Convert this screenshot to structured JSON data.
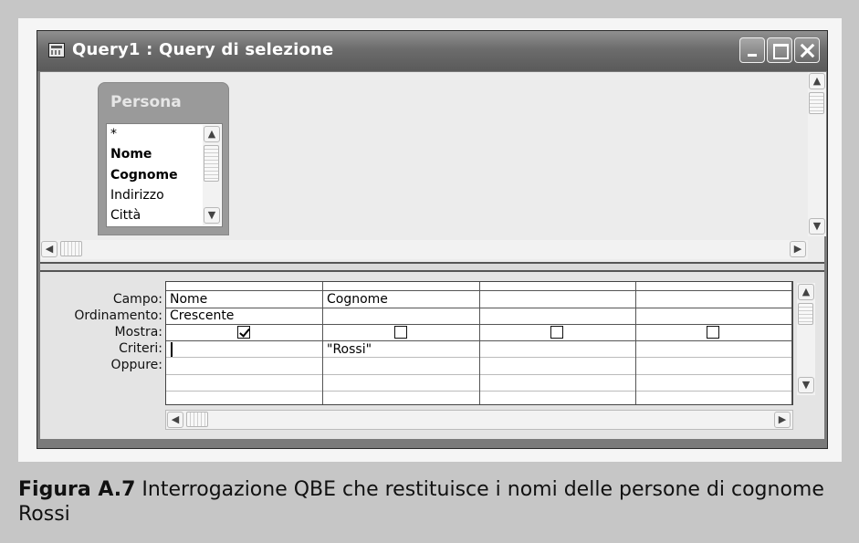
{
  "window": {
    "title": "Query1 : Query di selezione"
  },
  "table": {
    "name": "Persona",
    "fields": [
      {
        "label": "*",
        "bold": false
      },
      {
        "label": "Nome",
        "bold": true
      },
      {
        "label": "Cognome",
        "bold": true
      },
      {
        "label": "Indirizzo",
        "bold": false
      },
      {
        "label": "Città",
        "bold": false
      }
    ]
  },
  "grid": {
    "row_labels": [
      "Campo:",
      "Ordinamento:",
      "Mostra:",
      "Criteri:",
      "Oppure:"
    ],
    "columns": [
      {
        "campo": "Nome",
        "ordinamento": "Crescente",
        "mostra": true,
        "criteri": ""
      },
      {
        "campo": "Cognome",
        "ordinamento": "",
        "mostra": false,
        "criteri": "\"Rossi\""
      },
      {
        "campo": "",
        "ordinamento": "",
        "mostra": false,
        "criteri": ""
      },
      {
        "campo": "",
        "ordinamento": "",
        "mostra": false,
        "criteri": ""
      }
    ]
  },
  "caption": {
    "label": "Figura A.7",
    "text": " Interrogazione QBE che restituisce i nomi delle persone di cognome Rossi"
  }
}
